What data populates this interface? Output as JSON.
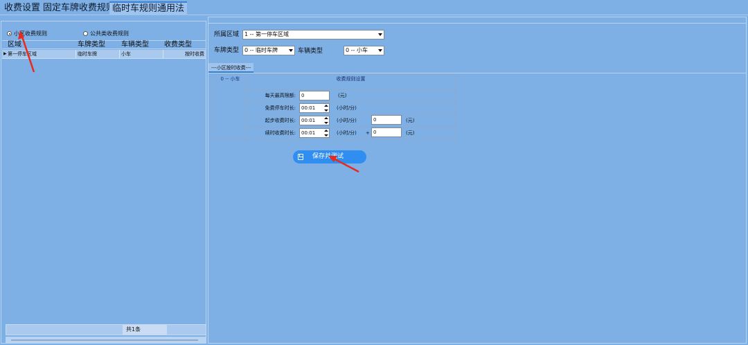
{
  "tabs": [
    {
      "label": "收费设置"
    },
    {
      "label": "固定车牌收费规则"
    },
    {
      "label": "临时车规则通用法"
    }
  ],
  "left_panel": {
    "radio_community": "小区收费规则",
    "radio_public": "公共类收费规则",
    "columns": [
      "区域",
      "车牌类型",
      "车辆类型",
      "收费类型"
    ],
    "rows": [
      {
        "area": "第一停车区域",
        "plate_type": "临时车牌",
        "vehicle_type": "小车",
        "fee_type": "按时收费"
      }
    ],
    "total": "共1条"
  },
  "form": {
    "area_label": "所属区域",
    "area_value": "1 -- 第一停车区域",
    "plate_type_label": "车牌类型",
    "plate_type_value": "0 -- 临时车牌",
    "vehicle_type_label": "车辆类型",
    "vehicle_type_value": "0 -- 小车"
  },
  "subtab": "---小区按时收费---",
  "rules": {
    "vehicle": "0 -- 小车",
    "title": "收费规则设置",
    "daily_max_label": "每天最高限额:",
    "daily_max_value": "0",
    "daily_max_unit": "(元)",
    "free_time_label": "免费停车时长:",
    "free_time_value": "00:01",
    "free_time_unit": "(小时/分)",
    "start_label": "起步收费时长:",
    "start_time_value": "00:01",
    "start_unit": "(小时/分)",
    "start_fee_value": "0",
    "start_fee_unit": "(元)",
    "cont_label": "续时收费时长:",
    "cont_time_value": "00:01",
    "cont_unit": "(小时/分)",
    "cont_plus": "+",
    "cont_fee_value": "0",
    "cont_fee_unit": "(元)"
  },
  "save_button": "保存并测试",
  "colors": {
    "background": "#7eb0e6",
    "button": "#2f8ef0",
    "annotation_arrow": "#e8291c"
  }
}
